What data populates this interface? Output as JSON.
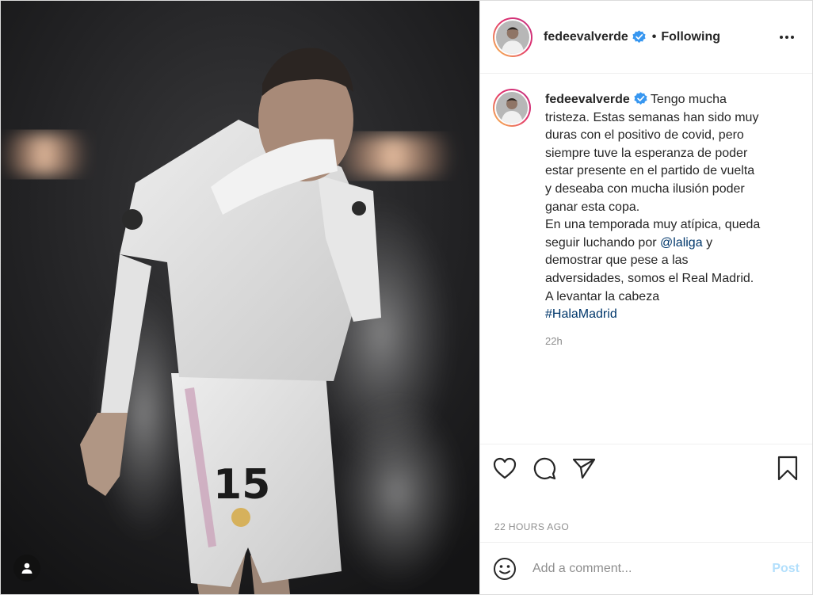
{
  "post": {
    "author": "fedeevalverde",
    "follow_state": "Following",
    "separator": "•",
    "caption_lines": [
      "Tengo mucha",
      "tristeza. Estas semanas han sido muy",
      "duras con el positivo de covid, pero",
      "siempre tuve la esperanza de poder",
      "estar presente en el partido de vuelta",
      "y deseaba con mucha ilusión poder",
      "ganar esta copa.",
      "En una temporada muy atípica, queda"
    ],
    "caption_mention_prefix": "seguir luchando por",
    "caption_mention": "@laliga",
    "caption_mention_suffix": "y",
    "caption_lines_after": [
      "demostrar que pese a las",
      "adversidades, somos el Real Madrid.",
      "A levantar la cabeza"
    ],
    "hashtag": "#HalaMadrid",
    "relative_time": "22h",
    "date_label": "22 HOURS AGO",
    "jersey_number": "15"
  },
  "comment_box": {
    "placeholder": "Add a comment...",
    "post_label": "Post"
  },
  "icons": {
    "verified": "verified-badge-icon",
    "more": "more-options-icon",
    "like": "heart-icon",
    "comment": "comment-bubble-icon",
    "share": "paper-plane-icon",
    "save": "bookmark-icon",
    "emoji": "emoji-icon",
    "tag": "user-tag-icon"
  },
  "colors": {
    "verified": "#3897f0",
    "link": "#00376b",
    "post_button_disabled": "#b2dffc",
    "muted": "#8e8e8e"
  }
}
